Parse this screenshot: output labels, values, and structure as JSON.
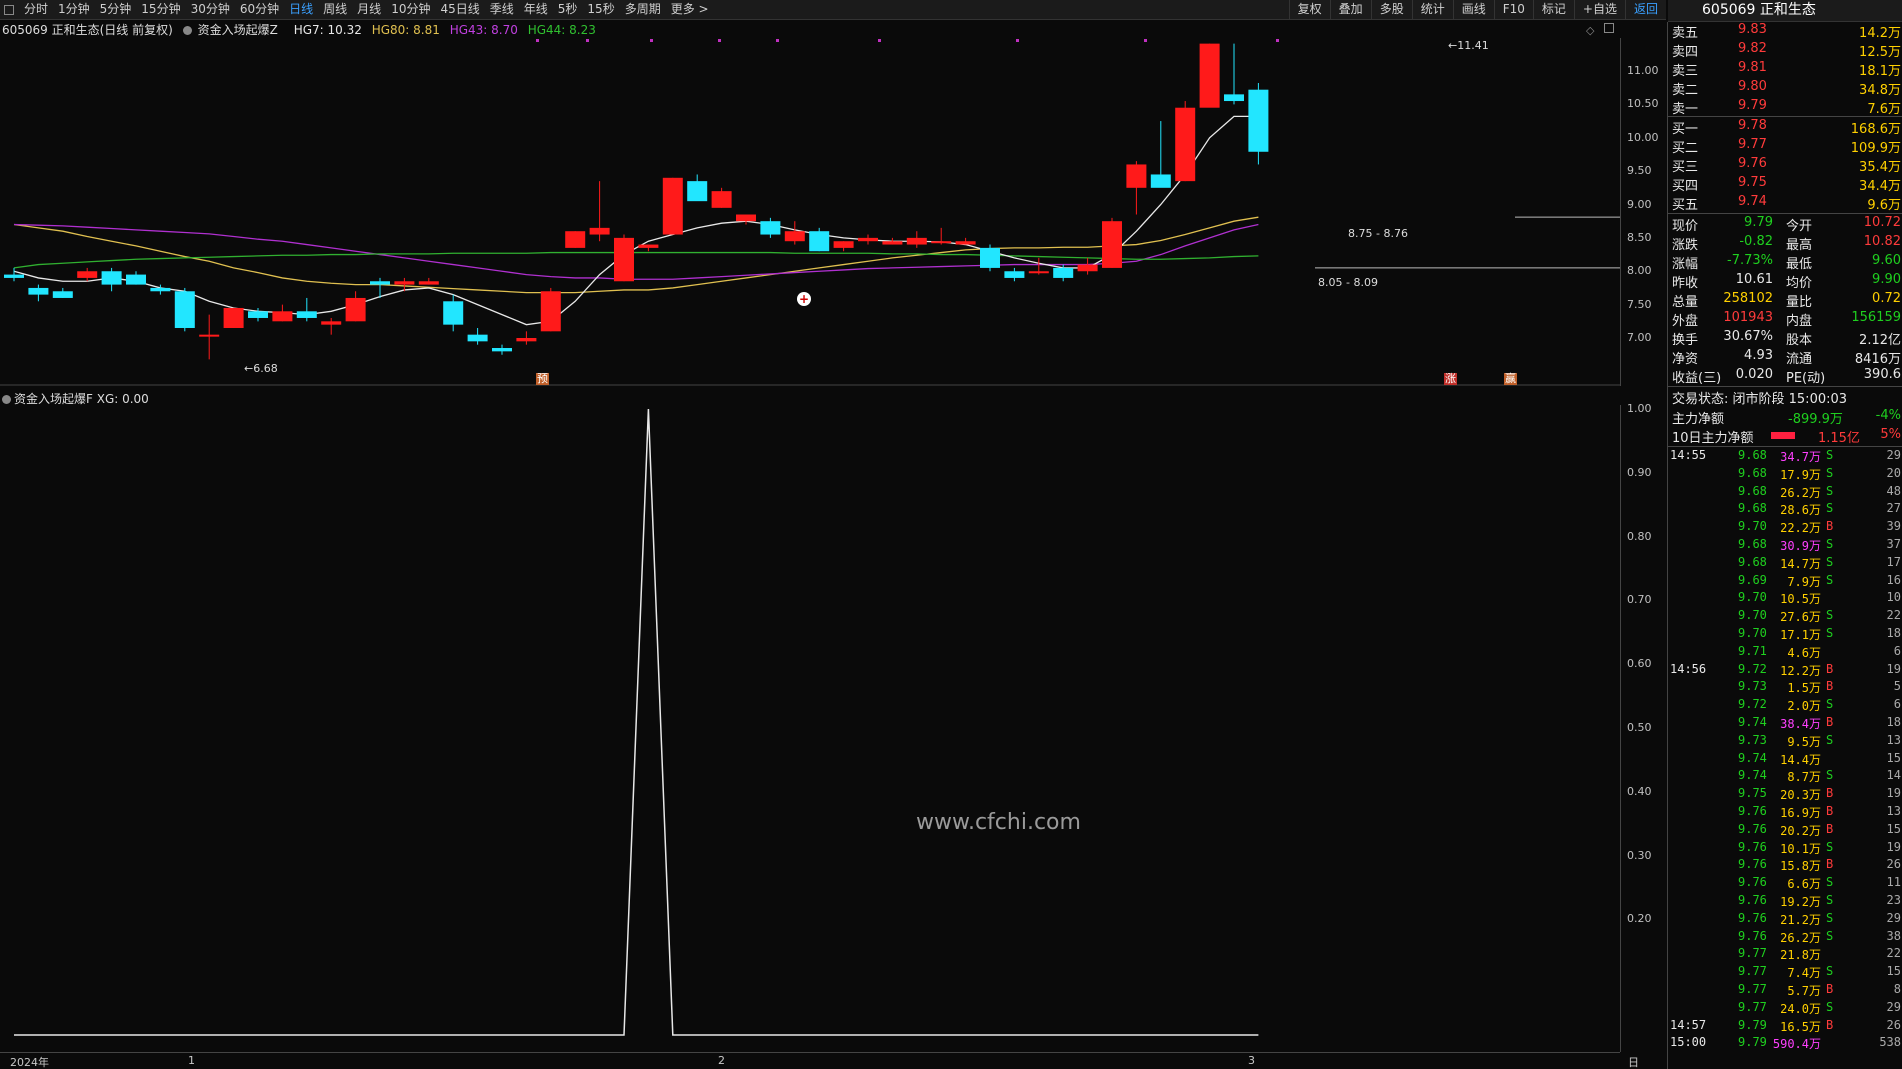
{
  "toolbar": {
    "periods": [
      "分时",
      "1分钟",
      "5分钟",
      "15分钟",
      "30分钟",
      "60分钟",
      "日线",
      "周线",
      "月线",
      "10分钟",
      "45日线",
      "季线",
      "年线",
      "5秒",
      "15秒",
      "多周期",
      "更多 >"
    ],
    "active_period": "日线",
    "right_buttons": [
      "复权",
      "叠加",
      "多股",
      "统计",
      "画线",
      "F10",
      "标记",
      "+自选",
      "返回"
    ]
  },
  "stock": {
    "code": "605069",
    "name": "正和生态"
  },
  "main_chart": {
    "header": {
      "title": "605069 正和生态(日线 前复权)",
      "indicator": "资金入场起爆Z",
      "hg7": "HG7: 10.32",
      "hg80": "HG80: 8.81",
      "hg43": "HG43: 8.70",
      "hg44": "HG44: 8.23"
    },
    "y_ticks": [
      "11.00",
      "10.50",
      "10.00",
      "9.50",
      "9.00",
      "8.50",
      "8.00",
      "7.50",
      "7.00"
    ],
    "annotations": {
      "high": "11.41",
      "low": "6.68",
      "range1": "8.75 - 8.76",
      "range2": "8.05 - 8.09",
      "mark_pre": "预",
      "mark_up": "涨",
      "mark_win": "赢"
    }
  },
  "indicator_panel": {
    "header": "资金入场起爆F  XG: 0.00",
    "y_ticks": [
      "1.00",
      "0.90",
      "0.80",
      "0.70",
      "0.60",
      "0.50",
      "0.40",
      "0.30",
      "0.20"
    ],
    "watermark": "www.cfchi.com"
  },
  "date_axis": {
    "labels": [
      "2024年",
      "1",
      "2",
      "3"
    ],
    "period": "日线"
  },
  "chart_data": {
    "type": "candlestick",
    "ylim": [
      6.5,
      11.6
    ],
    "ohlc": [
      [
        7.95,
        8.05,
        7.85,
        7.9
      ],
      [
        7.75,
        7.8,
        7.55,
        7.65
      ],
      [
        7.7,
        7.75,
        7.6,
        7.6
      ],
      [
        7.9,
        8.05,
        7.85,
        8.0
      ],
      [
        8.0,
        8.05,
        7.7,
        7.8
      ],
      [
        7.95,
        8.0,
        7.8,
        7.8
      ],
      [
        7.75,
        7.8,
        7.65,
        7.7
      ],
      [
        7.7,
        7.75,
        7.1,
        7.15
      ],
      [
        7.05,
        7.35,
        6.68,
        7.05
      ],
      [
        7.15,
        7.45,
        7.15,
        7.45
      ],
      [
        7.4,
        7.45,
        7.25,
        7.3
      ],
      [
        7.25,
        7.5,
        7.25,
        7.4
      ],
      [
        7.4,
        7.6,
        7.25,
        7.3
      ],
      [
        7.2,
        7.3,
        7.05,
        7.25
      ],
      [
        7.25,
        7.7,
        7.25,
        7.6
      ],
      [
        7.85,
        7.9,
        7.6,
        7.8
      ],
      [
        7.8,
        7.9,
        7.7,
        7.85
      ],
      [
        7.8,
        7.9,
        7.8,
        7.85
      ],
      [
        7.55,
        7.65,
        7.1,
        7.2
      ],
      [
        7.05,
        7.15,
        6.9,
        6.95
      ],
      [
        6.85,
        6.9,
        6.75,
        6.8
      ],
      [
        6.95,
        7.1,
        6.9,
        7.0
      ],
      [
        7.1,
        7.75,
        7.1,
        7.7
      ],
      [
        8.35,
        8.6,
        8.35,
        8.6
      ],
      [
        8.55,
        9.35,
        8.45,
        8.65
      ],
      [
        7.85,
        8.55,
        7.85,
        8.5
      ],
      [
        8.35,
        8.4,
        8.3,
        8.4
      ],
      [
        8.55,
        9.4,
        8.55,
        9.4
      ],
      [
        9.35,
        9.45,
        9.1,
        9.05
      ],
      [
        8.95,
        9.25,
        8.95,
        9.2
      ],
      [
        8.75,
        8.85,
        8.7,
        8.85
      ],
      [
        8.75,
        8.8,
        8.5,
        8.55
      ],
      [
        8.45,
        8.75,
        8.4,
        8.6
      ],
      [
        8.6,
        8.65,
        8.3,
        8.3
      ],
      [
        8.35,
        8.45,
        8.3,
        8.45
      ],
      [
        8.45,
        8.55,
        8.4,
        8.5
      ],
      [
        8.4,
        8.5,
        8.4,
        8.45
      ],
      [
        8.4,
        8.6,
        8.35,
        8.5
      ],
      [
        8.45,
        8.65,
        8.4,
        8.45
      ],
      [
        8.4,
        8.5,
        8.4,
        8.45
      ],
      [
        8.35,
        8.4,
        8.0,
        8.05
      ],
      [
        8.0,
        8.05,
        7.85,
        7.9
      ],
      [
        8.0,
        8.2,
        7.95,
        8.0
      ],
      [
        8.05,
        8.1,
        7.85,
        7.9
      ],
      [
        8.0,
        8.2,
        7.95,
        8.1
      ],
      [
        8.05,
        8.8,
        8.05,
        8.75
      ],
      [
        9.25,
        9.65,
        8.85,
        9.6
      ],
      [
        9.45,
        10.25,
        9.45,
        9.25
      ],
      [
        9.35,
        10.55,
        9.35,
        10.45
      ],
      [
        10.45,
        11.41,
        10.5,
        11.41
      ],
      [
        10.65,
        11.41,
        10.5,
        10.55
      ],
      [
        10.72,
        10.82,
        9.6,
        9.79
      ]
    ],
    "series": [
      {
        "name": "HG80",
        "color": "#e0c050",
        "values": [
          8.7,
          8.65,
          8.6,
          8.52,
          8.45,
          8.38,
          8.3,
          8.22,
          8.15,
          8.05,
          7.98,
          7.9,
          7.85,
          7.82,
          7.8,
          7.8,
          7.78,
          7.76,
          7.74,
          7.72,
          7.7,
          7.68,
          7.68,
          7.68,
          7.7,
          7.72,
          7.72,
          7.75,
          7.8,
          7.85,
          7.9,
          7.95,
          8.0,
          8.05,
          8.1,
          8.15,
          8.2,
          8.24,
          8.28,
          8.32,
          8.34,
          8.35,
          8.35,
          8.36,
          8.36,
          8.38,
          8.4,
          8.46,
          8.55,
          8.65,
          8.75,
          8.81
        ]
      },
      {
        "name": "HG43",
        "color": "#b030d0",
        "values": [
          8.7,
          8.69,
          8.68,
          8.66,
          8.64,
          8.62,
          8.6,
          8.58,
          8.56,
          8.52,
          8.48,
          8.45,
          8.4,
          8.35,
          8.3,
          8.25,
          8.2,
          8.15,
          8.1,
          8.05,
          8.0,
          7.95,
          7.92,
          7.9,
          7.9,
          7.88,
          7.88,
          7.88,
          7.9,
          7.92,
          7.94,
          7.96,
          7.98,
          8.0,
          8.02,
          8.04,
          8.05,
          8.06,
          8.07,
          8.08,
          8.09,
          8.1,
          8.1,
          8.1,
          8.1,
          8.12,
          8.15,
          8.25,
          8.38,
          8.5,
          8.62,
          8.7
        ]
      },
      {
        "name": "HG44",
        "color": "#30b030",
        "values": [
          8.05,
          8.1,
          8.12,
          8.14,
          8.16,
          8.18,
          8.19,
          8.2,
          8.21,
          8.22,
          8.23,
          8.24,
          8.24,
          8.25,
          8.25,
          8.26,
          8.26,
          8.26,
          8.27,
          8.27,
          8.27,
          8.27,
          8.28,
          8.28,
          8.28,
          8.28,
          8.28,
          8.28,
          8.28,
          8.28,
          8.28,
          8.28,
          8.27,
          8.27,
          8.27,
          8.27,
          8.26,
          8.26,
          8.25,
          8.25,
          8.24,
          8.23,
          8.22,
          8.21,
          8.2,
          8.19,
          8.18,
          8.18,
          8.19,
          8.2,
          8.22,
          8.23
        ]
      },
      {
        "name": "HG7",
        "color": "#e8e8e8",
        "values": [
          8.0,
          7.9,
          7.85,
          7.85,
          7.9,
          7.85,
          7.75,
          7.7,
          7.55,
          7.45,
          7.4,
          7.38,
          7.35,
          7.4,
          7.5,
          7.62,
          7.72,
          7.75,
          7.65,
          7.5,
          7.35,
          7.2,
          7.25,
          7.55,
          7.95,
          8.25,
          8.45,
          8.55,
          8.65,
          8.72,
          8.75,
          8.7,
          8.62,
          8.55,
          8.5,
          8.47,
          8.45,
          8.45,
          8.44,
          8.4,
          8.3,
          8.2,
          8.12,
          8.05,
          8.05,
          8.25,
          8.6,
          9.0,
          9.45,
          10.0,
          10.32,
          10.32
        ]
      }
    ],
    "xg_values": [
      0,
      0,
      0,
      0,
      0,
      0,
      0,
      0,
      0,
      0,
      0,
      0,
      0,
      0,
      0,
      0,
      0,
      0,
      0,
      0,
      0,
      0,
      0,
      0,
      0,
      0,
      1,
      0,
      0,
      0,
      0,
      0,
      0,
      0,
      0,
      0,
      0,
      0,
      0,
      0,
      0,
      0,
      0,
      0,
      0,
      0,
      0,
      0,
      0,
      0,
      0,
      0
    ]
  },
  "quote": {
    "asks": [
      {
        "label": "卖五",
        "price": "9.83",
        "vol": "14.2万"
      },
      {
        "label": "卖四",
        "price": "9.82",
        "vol": "12.5万"
      },
      {
        "label": "卖三",
        "price": "9.81",
        "vol": "18.1万"
      },
      {
        "label": "卖二",
        "price": "9.80",
        "vol": "34.8万"
      },
      {
        "label": "卖一",
        "price": "9.79",
        "vol": "7.6万"
      }
    ],
    "bids": [
      {
        "label": "买一",
        "price": "9.78",
        "vol": "168.6万"
      },
      {
        "label": "买二",
        "price": "9.77",
        "vol": "109.9万"
      },
      {
        "label": "买三",
        "price": "9.76",
        "vol": "35.4万"
      },
      {
        "label": "买四",
        "price": "9.75",
        "vol": "34.4万"
      },
      {
        "label": "买五",
        "price": "9.74",
        "vol": "9.6万"
      }
    ],
    "stats": [
      {
        "l1": "现价",
        "v1": "9.79",
        "c1": "green",
        "l2": "今开",
        "v2": "10.72",
        "c2": "red"
      },
      {
        "l1": "涨跌",
        "v1": "-0.82",
        "c1": "green",
        "l2": "最高",
        "v2": "10.82",
        "c2": "red"
      },
      {
        "l1": "涨幅",
        "v1": "-7.73%",
        "c1": "green",
        "l2": "最低",
        "v2": "9.60",
        "c2": "green"
      },
      {
        "l1": "昨收",
        "v1": "10.61",
        "c1": "white",
        "l2": "均价",
        "v2": "9.90",
        "c2": "green"
      },
      {
        "l1": "总量",
        "v1": "258102",
        "c1": "yel",
        "l2": "量比",
        "v2": "0.72",
        "c2": "yel"
      },
      {
        "l1": "外盘",
        "v1": "101943",
        "c1": "red",
        "l2": "内盘",
        "v2": "156159",
        "c2": "green"
      },
      {
        "l1": "换手",
        "v1": "30.67%",
        "c1": "white",
        "l2": "股本",
        "v2": "2.12亿",
        "c2": "white"
      },
      {
        "l1": "净资",
        "v1": "4.93",
        "c1": "white",
        "l2": "流通",
        "v2": "8416万",
        "c2": "white"
      },
      {
        "l1": "收益(三)",
        "v1": "0.020",
        "c1": "white",
        "l2": "PE(动)",
        "v2": "390.6",
        "c2": "white"
      }
    ],
    "trade_status": "交易状态: 闭市阶段 15:00:03",
    "main_net": {
      "label": "主力净额",
      "value": "-899.9万",
      "pct": "-4%"
    },
    "net10": {
      "label": "10日主力净额",
      "value": "1.15亿",
      "pct": "5%"
    }
  },
  "ticks": [
    {
      "t": "14:55",
      "p": "9.68",
      "v": "34.7万",
      "vc": "mag",
      "d": "S",
      "n": "29"
    },
    {
      "t": "",
      "p": "9.68",
      "v": "17.9万",
      "vc": "yel",
      "d": "S",
      "n": "20"
    },
    {
      "t": "",
      "p": "9.68",
      "v": "26.2万",
      "vc": "yel",
      "d": "S",
      "n": "48"
    },
    {
      "t": "",
      "p": "9.68",
      "v": "28.6万",
      "vc": "yel",
      "d": "S",
      "n": "27"
    },
    {
      "t": "",
      "p": "9.70",
      "v": "22.2万",
      "vc": "yel",
      "d": "B",
      "n": "39"
    },
    {
      "t": "",
      "p": "9.68",
      "v": "30.9万",
      "vc": "mag",
      "d": "S",
      "n": "37"
    },
    {
      "t": "",
      "p": "9.68",
      "v": "14.7万",
      "vc": "yel",
      "d": "S",
      "n": "17"
    },
    {
      "t": "",
      "p": "9.69",
      "v": "7.9万",
      "vc": "yel",
      "d": "S",
      "n": "16"
    },
    {
      "t": "",
      "p": "9.70",
      "v": "10.5万",
      "vc": "yel",
      "d": "",
      "n": "10"
    },
    {
      "t": "",
      "p": "9.70",
      "v": "27.6万",
      "vc": "yel",
      "d": "S",
      "n": "22"
    },
    {
      "t": "",
      "p": "9.70",
      "v": "17.1万",
      "vc": "yel",
      "d": "S",
      "n": "18"
    },
    {
      "t": "",
      "p": "9.71",
      "v": "4.6万",
      "vc": "yel",
      "d": "",
      "n": "6"
    },
    {
      "t": "14:56",
      "p": "9.72",
      "v": "12.2万",
      "vc": "yel",
      "d": "B",
      "n": "19"
    },
    {
      "t": "",
      "p": "9.73",
      "v": "1.5万",
      "vc": "yel",
      "d": "B",
      "n": "5"
    },
    {
      "t": "",
      "p": "9.72",
      "v": "2.0万",
      "vc": "yel",
      "d": "S",
      "n": "6"
    },
    {
      "t": "",
      "p": "9.74",
      "v": "38.4万",
      "vc": "mag",
      "d": "B",
      "n": "18"
    },
    {
      "t": "",
      "p": "9.73",
      "v": "9.5万",
      "vc": "yel",
      "d": "S",
      "n": "13"
    },
    {
      "t": "",
      "p": "9.74",
      "v": "14.4万",
      "vc": "yel",
      "d": "",
      "n": "15"
    },
    {
      "t": "",
      "p": "9.74",
      "v": "8.7万",
      "vc": "yel",
      "d": "S",
      "n": "14"
    },
    {
      "t": "",
      "p": "9.75",
      "v": "20.3万",
      "vc": "yel",
      "d": "B",
      "n": "19"
    },
    {
      "t": "",
      "p": "9.76",
      "v": "16.9万",
      "vc": "yel",
      "d": "B",
      "n": "13"
    },
    {
      "t": "",
      "p": "9.76",
      "v": "20.2万",
      "vc": "yel",
      "d": "B",
      "n": "15"
    },
    {
      "t": "",
      "p": "9.76",
      "v": "10.1万",
      "vc": "yel",
      "d": "S",
      "n": "19"
    },
    {
      "t": "",
      "p": "9.76",
      "v": "15.8万",
      "vc": "yel",
      "d": "B",
      "n": "26"
    },
    {
      "t": "",
      "p": "9.76",
      "v": "6.6万",
      "vc": "yel",
      "d": "S",
      "n": "11"
    },
    {
      "t": "",
      "p": "9.76",
      "v": "19.2万",
      "vc": "yel",
      "d": "S",
      "n": "23"
    },
    {
      "t": "",
      "p": "9.76",
      "v": "21.2万",
      "vc": "yel",
      "d": "S",
      "n": "29"
    },
    {
      "t": "",
      "p": "9.76",
      "v": "26.2万",
      "vc": "yel",
      "d": "S",
      "n": "38"
    },
    {
      "t": "",
      "p": "9.77",
      "v": "21.8万",
      "vc": "yel",
      "d": "",
      "n": "22"
    },
    {
      "t": "",
      "p": "9.77",
      "v": "7.4万",
      "vc": "yel",
      "d": "S",
      "n": "15"
    },
    {
      "t": "",
      "p": "9.77",
      "v": "5.7万",
      "vc": "yel",
      "d": "B",
      "n": "8"
    },
    {
      "t": "",
      "p": "9.77",
      "v": "24.0万",
      "vc": "yel",
      "d": "S",
      "n": "29"
    },
    {
      "t": "14:57",
      "p": "9.79",
      "v": "16.5万",
      "vc": "yel",
      "d": "B",
      "n": "26"
    },
    {
      "t": "15:00",
      "p": "9.79",
      "v": "590.4万",
      "vc": "mag",
      "d": "",
      "n": "538"
    }
  ]
}
